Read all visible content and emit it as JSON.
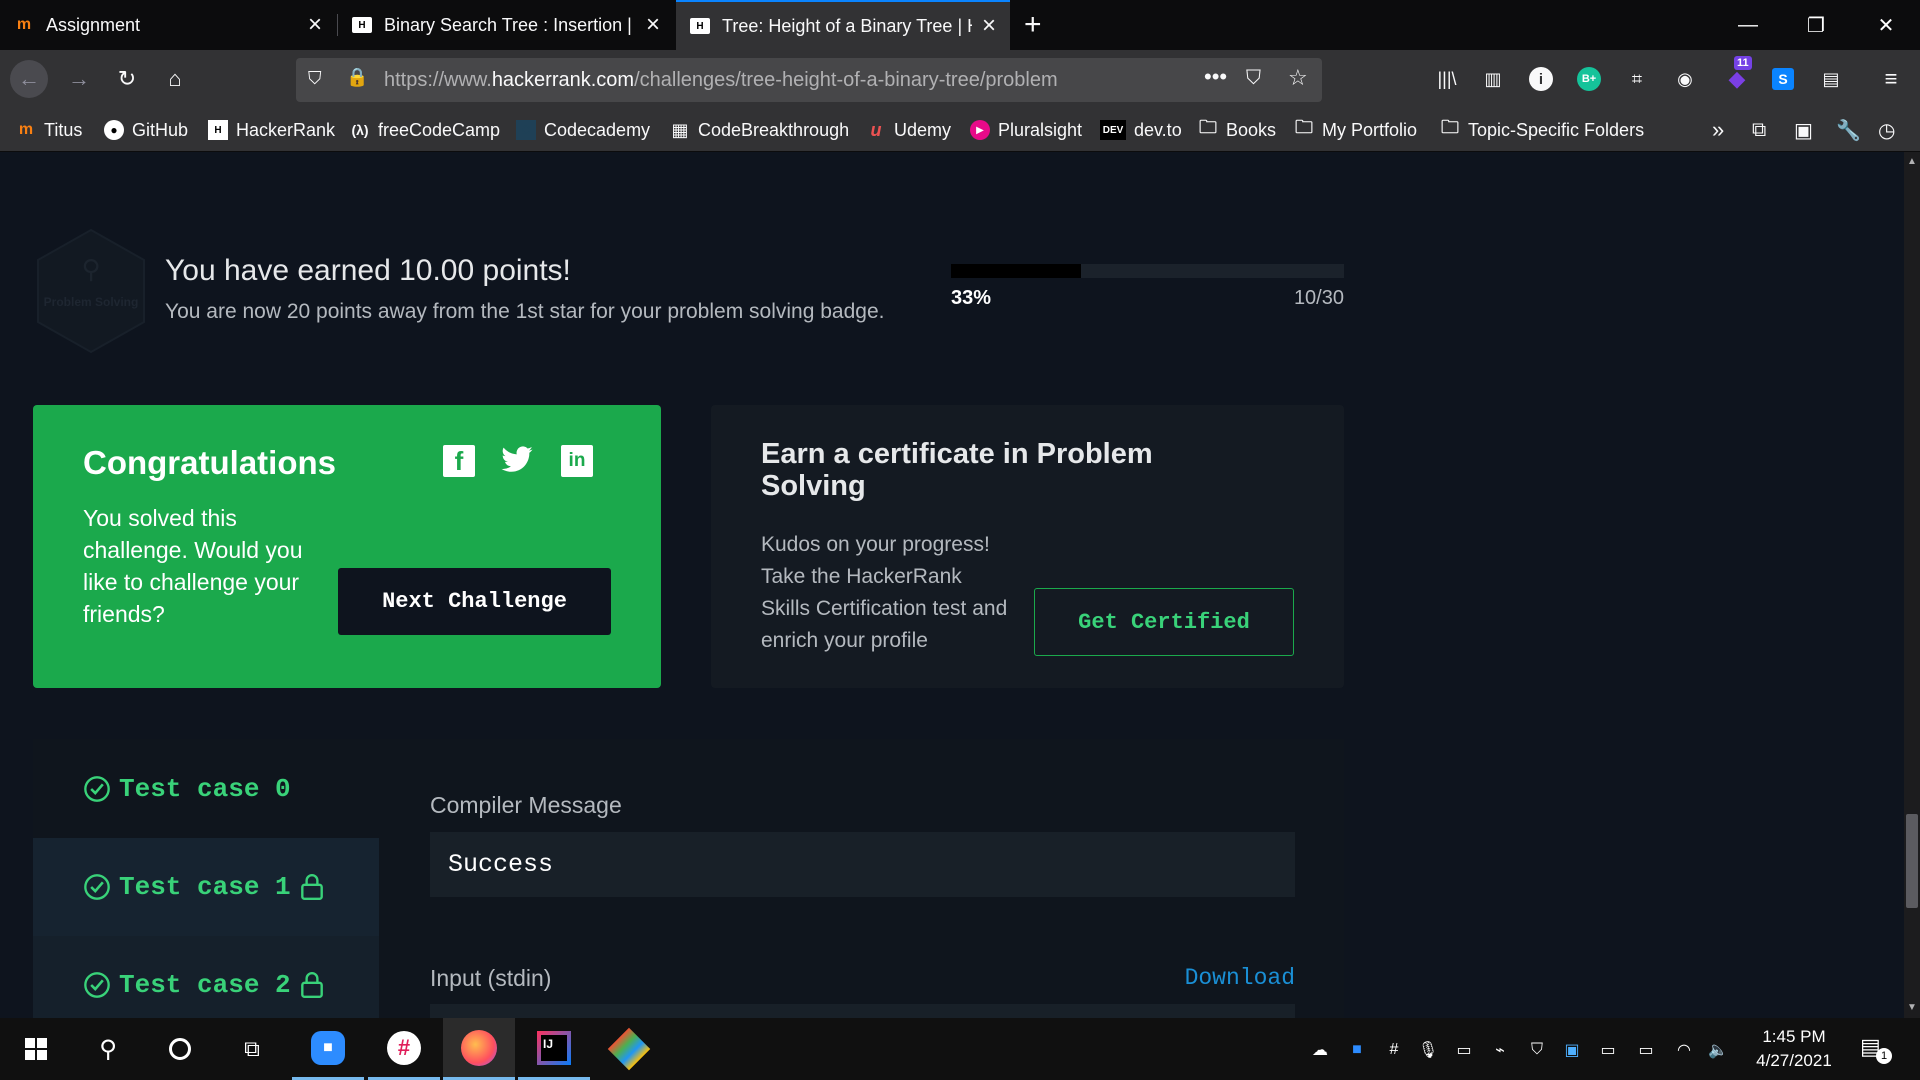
{
  "browser": {
    "tabs": [
      {
        "title": "Assignment",
        "favicon": "moodle-icon"
      },
      {
        "title": "Binary Search Tree : Insertion | H",
        "favicon": "hackerrank-icon"
      },
      {
        "title": "Tree: Height of a Binary Tree | H",
        "favicon": "hackerrank-icon"
      }
    ],
    "url_prefix": "https://www.",
    "url_domain": "hackerrank.com",
    "url_path": "/challenges/tree-height-of-a-binary-tree/problem",
    "extension_badge": "11",
    "bookmarks": [
      {
        "label": "Titus",
        "icon": "moodle-icon"
      },
      {
        "label": "GitHub",
        "icon": "github-icon"
      },
      {
        "label": "HackerRank",
        "icon": "hackerrank-icon"
      },
      {
        "label": "freeCodeCamp",
        "icon": "freecodecamp-icon"
      },
      {
        "label": "Codecademy",
        "icon": "codecademy-icon"
      },
      {
        "label": "CodeBreakthrough",
        "icon": "building-icon"
      },
      {
        "label": "Udemy",
        "icon": "udemy-icon"
      },
      {
        "label": "Pluralsight",
        "icon": "pluralsight-icon"
      },
      {
        "label": "dev.to",
        "icon": "devto-icon"
      },
      {
        "label": "Books",
        "icon": "folder-icon"
      },
      {
        "label": "My Portfolio",
        "icon": "folder-icon"
      },
      {
        "label": "Topic-Specific Folders",
        "icon": "folder-icon"
      }
    ],
    "devto_icon_text": "DEV"
  },
  "points": {
    "badge_label": "Problem Solving",
    "title": "You have earned 10.00 points!",
    "subtitle": "You are now 20 points away from the 1st star for your problem solving badge.",
    "percent_text": "33%",
    "progress_fraction": 0.33,
    "count_text": "10/30"
  },
  "congrats": {
    "title": "Congratulations",
    "text": "You solved this challenge. Would you like to challenge your friends?",
    "button": "Next Challenge"
  },
  "certificate": {
    "title": "Earn a certificate in Problem Solving",
    "text": "Kudos on your progress! Take the HackerRank Skills Certification test and enrich your profile",
    "button": "Get Certified"
  },
  "testcases": [
    {
      "label": "Test case 0",
      "locked": false
    },
    {
      "label": "Test case 1",
      "locked": true
    },
    {
      "label": "Test case 2",
      "locked": true
    }
  ],
  "compiler": {
    "label": "Compiler Message",
    "value": "Success",
    "input_label": "Input (stdin)",
    "download": "Download"
  },
  "taskbar": {
    "time": "1:45 PM",
    "date": "4/27/2021",
    "notification_count": "1"
  },
  "colors": {
    "hr_green": "#1ba94c",
    "page_bg": "#0e141e",
    "card_bg": "#141a22",
    "accent_blue": "#1a8fd5"
  }
}
